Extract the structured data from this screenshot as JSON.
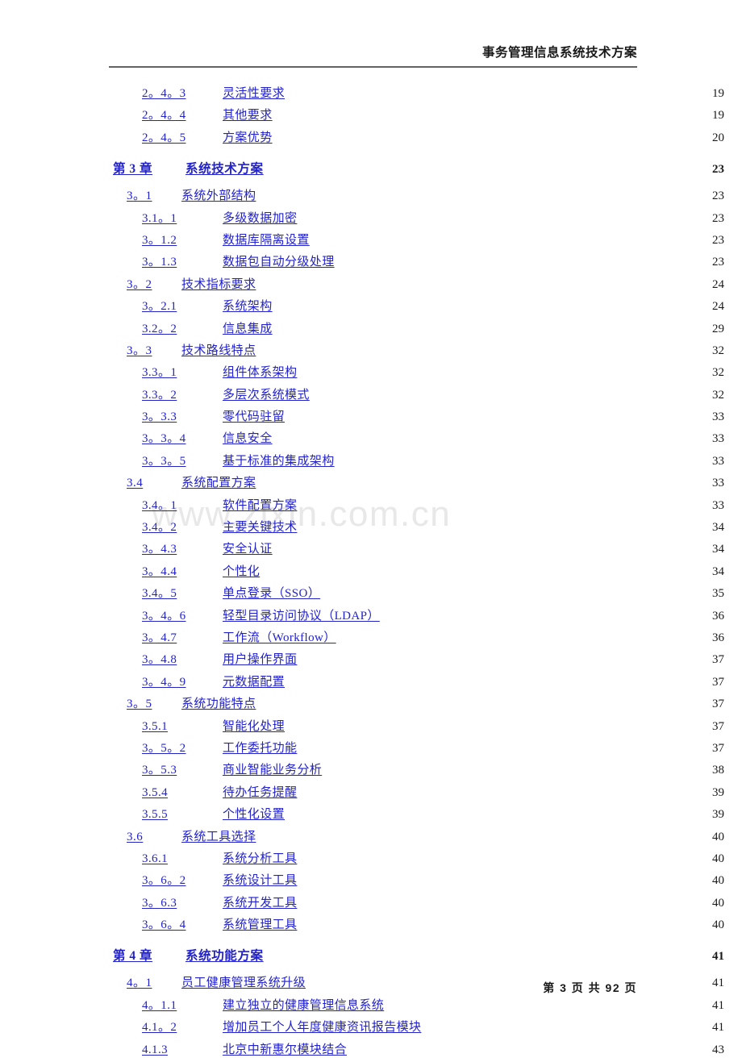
{
  "header": {
    "title": "事务管理信息系统技术方案"
  },
  "watermark": {
    "text": "www.zixin.com.cn"
  },
  "footer": {
    "text": "第 3 页 共 92 页"
  },
  "toc": {
    "entries": [
      {
        "level": 3,
        "num": "2。4。3",
        "title": "灵活性要求",
        "page": "19"
      },
      {
        "level": 3,
        "num": "2。4。4",
        "title": "其他要求",
        "page": "19"
      },
      {
        "level": 3,
        "num": "2。4。5",
        "title": "方案优势",
        "page": "20"
      },
      {
        "level": 1,
        "num": "第 3 章",
        "title": "系统技术方案",
        "page": "23"
      },
      {
        "level": 2,
        "num": "3。1",
        "title": "系统外部结构",
        "page": "23"
      },
      {
        "level": 3,
        "num": "3.1。1",
        "title": "多级数据加密",
        "page": "23"
      },
      {
        "level": 3,
        "num": "3。1.2",
        "title": "数据库隔离设置",
        "page": "23"
      },
      {
        "level": 3,
        "num": "3。1.3",
        "title": "数据包自动分级处理",
        "page": "23"
      },
      {
        "level": 2,
        "num": "3。2",
        "title": "技术指标要求",
        "page": "24"
      },
      {
        "level": 3,
        "num": "3。2.1",
        "title": "系统架构",
        "page": "24"
      },
      {
        "level": 3,
        "num": "3.2。2",
        "title": "信息集成",
        "page": "29"
      },
      {
        "level": 2,
        "num": "3。3",
        "title": "技术路线特点",
        "page": "32"
      },
      {
        "level": 3,
        "num": "3.3。1",
        "title": "组件体系架构",
        "page": "32"
      },
      {
        "level": 3,
        "num": "3.3。2",
        "title": "多层次系统模式",
        "page": "32"
      },
      {
        "level": 3,
        "num": "3。3.3",
        "title": "零代码驻留",
        "page": "33"
      },
      {
        "level": 3,
        "num": "3。3。4",
        "title": "信息安全",
        "page": "33"
      },
      {
        "level": 3,
        "num": "3。3。5",
        "title": "基于标准的集成架构",
        "page": "33"
      },
      {
        "level": 2,
        "num": "3.4",
        "title": "系统配置方案",
        "page": "33"
      },
      {
        "level": 3,
        "num": "3.4。1",
        "title": "软件配置方案",
        "page": "33"
      },
      {
        "level": 3,
        "num": "3.4。2",
        "title": "主要关键技术",
        "page": "34"
      },
      {
        "level": 3,
        "num": "3。4.3",
        "title": "安全认证",
        "page": "34"
      },
      {
        "level": 3,
        "num": "3。4.4",
        "title": "个性化",
        "page": "34"
      },
      {
        "level": 3,
        "num": "3.4。5",
        "title": "单点登录（SSO）",
        "page": "35"
      },
      {
        "level": 3,
        "num": "3。4。6",
        "title": "轻型目录访问协议（LDAP）",
        "page": "36"
      },
      {
        "level": 3,
        "num": "3。4.7",
        "title": "工作流（Workflow）",
        "page": "36"
      },
      {
        "level": 3,
        "num": "3。4.8",
        "title": "用户操作界面",
        "page": "37"
      },
      {
        "level": 3,
        "num": "3。4。9",
        "title": "元数据配置",
        "page": "37"
      },
      {
        "level": 2,
        "num": "3。5",
        "title": "系统功能特点",
        "page": "37"
      },
      {
        "level": 3,
        "num": "3.5.1",
        "title": "智能化处理",
        "page": "37"
      },
      {
        "level": 3,
        "num": "3。5。2",
        "title": "工作委托功能",
        "page": "37"
      },
      {
        "level": 3,
        "num": "3。5.3",
        "title": "商业智能业务分析",
        "page": "38"
      },
      {
        "level": 3,
        "num": "3.5.4",
        "title": "待办任务提醒",
        "page": "39"
      },
      {
        "level": 3,
        "num": "3.5.5",
        "title": "个性化设置",
        "page": "39"
      },
      {
        "level": 2,
        "num": "3.6",
        "title": "系统工具选择",
        "page": "40"
      },
      {
        "level": 3,
        "num": "3.6.1",
        "title": "系统分析工具",
        "page": "40"
      },
      {
        "level": 3,
        "num": "3。6。2",
        "title": "系统设计工具",
        "page": "40"
      },
      {
        "level": 3,
        "num": "3。6.3",
        "title": "系统开发工具",
        "page": "40"
      },
      {
        "level": 3,
        "num": "3。6。4",
        "title": "系统管理工具",
        "page": "40"
      },
      {
        "level": 1,
        "num": "第 4 章",
        "title": "系统功能方案",
        "page": "41"
      },
      {
        "level": 2,
        "num": "4。1",
        "title": "员工健康管理系统升级",
        "page": "41"
      },
      {
        "level": 3,
        "num": "4。1.1",
        "title": "建立独立的健康管理信息系统",
        "page": "41"
      },
      {
        "level": 3,
        "num": "4.1。2",
        "title": "增加员工个人年度健康资讯报告模块",
        "page": "41"
      },
      {
        "level": 3,
        "num": "4.1.3",
        "title": "北京中新惠尔模块结合",
        "page": "43"
      }
    ]
  }
}
